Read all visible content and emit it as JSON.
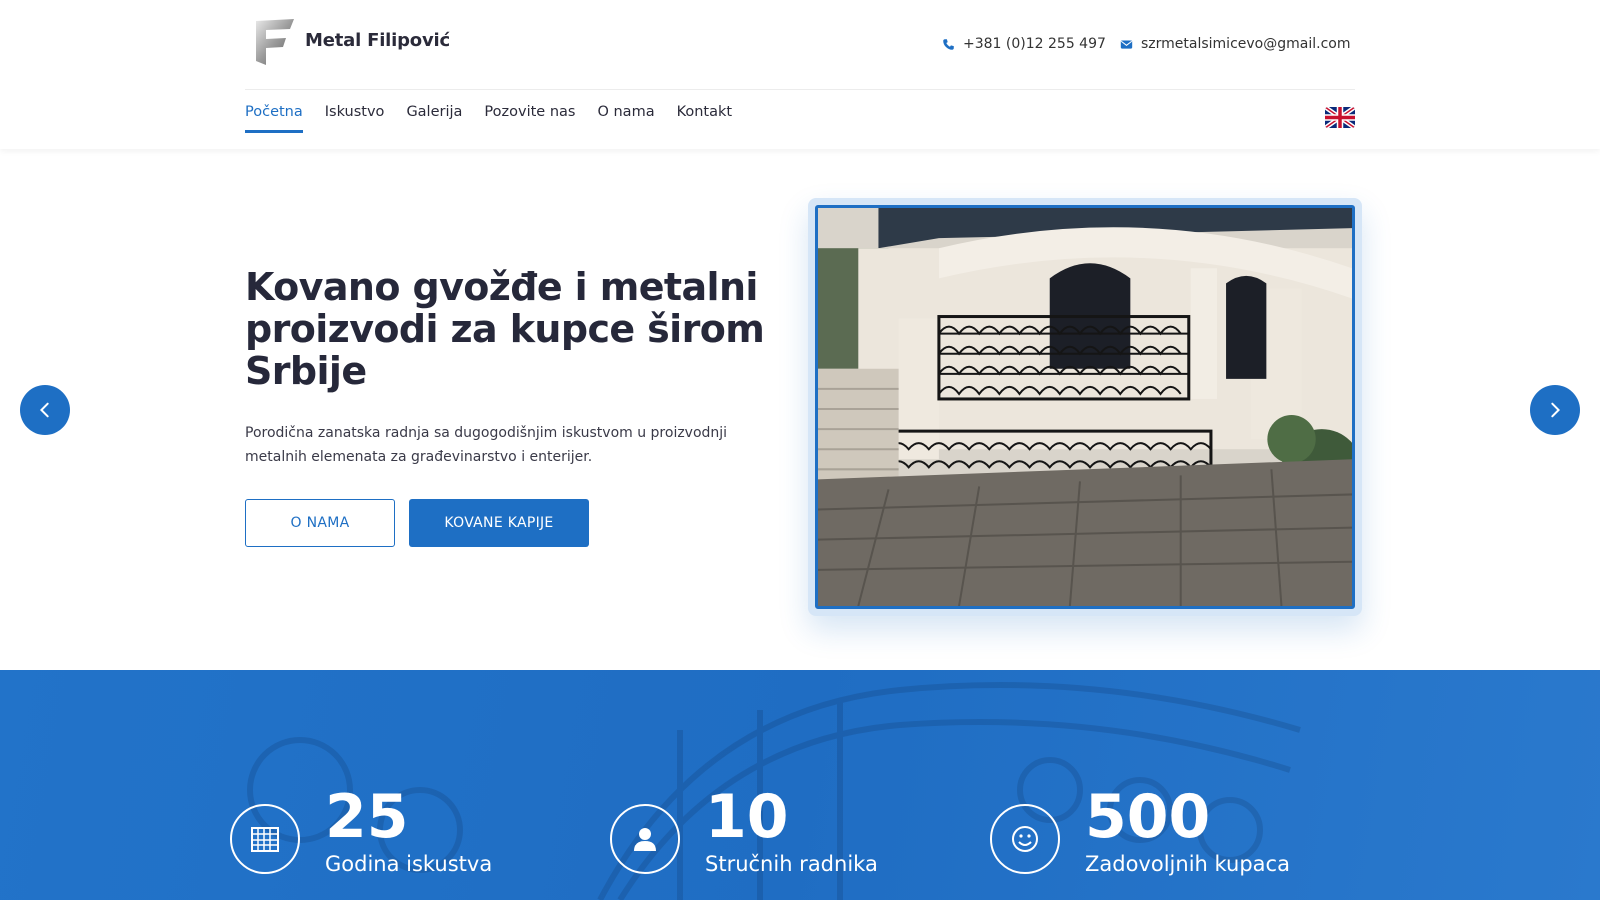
{
  "brand": {
    "name": "Metal Filipović"
  },
  "contact": {
    "phone": "+381 (0)12 255 497",
    "email": "szrmetalsimicevo@gmail.com"
  },
  "nav": {
    "items": [
      {
        "label": "Početna",
        "active": true
      },
      {
        "label": "Iskustvo",
        "active": false
      },
      {
        "label": "Galerija",
        "active": false
      },
      {
        "label": "Pozovite nas",
        "active": false
      },
      {
        "label": "O nama",
        "active": false
      },
      {
        "label": "Kontakt",
        "active": false
      }
    ],
    "language_icon": "uk-flag-icon"
  },
  "hero": {
    "title": "Kovano gvožđe i metalni proizvodi za kupce širom Srbije",
    "text": "Porodična zanatska radnja sa dugogodišnjim iskustvom u proizvodnji metalnih elemenata za građevinarstvo i enterijer.",
    "btn_outline": "O NAMA",
    "btn_solid": "KOVANE KAPIJE"
  },
  "stats": [
    {
      "value": "25",
      "label": "Godina iskustva",
      "icon": "calendar-icon"
    },
    {
      "value": "10",
      "label": "Stručnih radnika",
      "icon": "user-icon"
    },
    {
      "value": "500",
      "label": "Zadovoljnih kupaca",
      "icon": "smile-icon"
    }
  ],
  "colors": {
    "accent": "#1e6fc4",
    "text": "#26283a",
    "band": "#2273c9"
  }
}
